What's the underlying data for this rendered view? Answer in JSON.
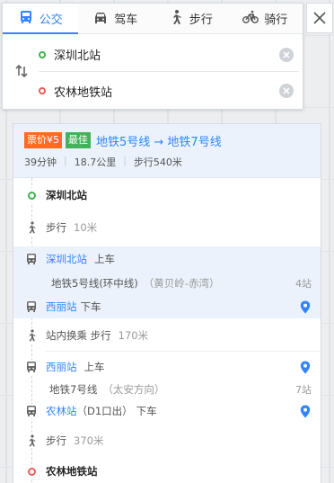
{
  "tabs": [
    {
      "label": "公交",
      "icon": "bus-icon",
      "active": true
    },
    {
      "label": "驾车",
      "icon": "car-icon",
      "active": false
    },
    {
      "label": "步行",
      "icon": "walk-icon",
      "active": false
    },
    {
      "label": "骑行",
      "icon": "bike-icon",
      "active": false
    }
  ],
  "route": {
    "start": "深圳北站",
    "end": "农林地铁站"
  },
  "summary": {
    "price": "票价¥5",
    "best": "最佳",
    "lines": "地铁5号线 → 地铁7号线",
    "duration": "39分钟",
    "distance": "18.7公里",
    "walk": "步行540米"
  },
  "steps": {
    "start_station": "深圳北站",
    "walk1_label": "步行",
    "walk1_dist": "10米",
    "board1_station": "深圳北站",
    "board1_action": "上车",
    "line1_name": "地铁5号线(环中线)",
    "line1_dir": "（黄贝岭-赤湾）",
    "line1_stops": "4站",
    "alight1_station": "西丽站",
    "alight1_action": "下车",
    "transfer_label": "站内换乘 步行",
    "transfer_dist": "170米",
    "board2_station": "西丽站",
    "board2_action": "上车",
    "line2_name": "地铁7号线",
    "line2_dir": "（太安方向）",
    "line2_stops": "7站",
    "alight2_station": "农林站",
    "alight2_exit": "（D1口出）",
    "alight2_action": "下车",
    "walk2_label": "步行",
    "walk2_dist": "370米",
    "end_station": "农林地铁站"
  },
  "colors": {
    "accent": "#3385ff",
    "price_badge": "#ff6b21",
    "best_badge": "#45b25b",
    "start_dot": "#3fb34f",
    "end_dot": "#ef5b5b"
  }
}
